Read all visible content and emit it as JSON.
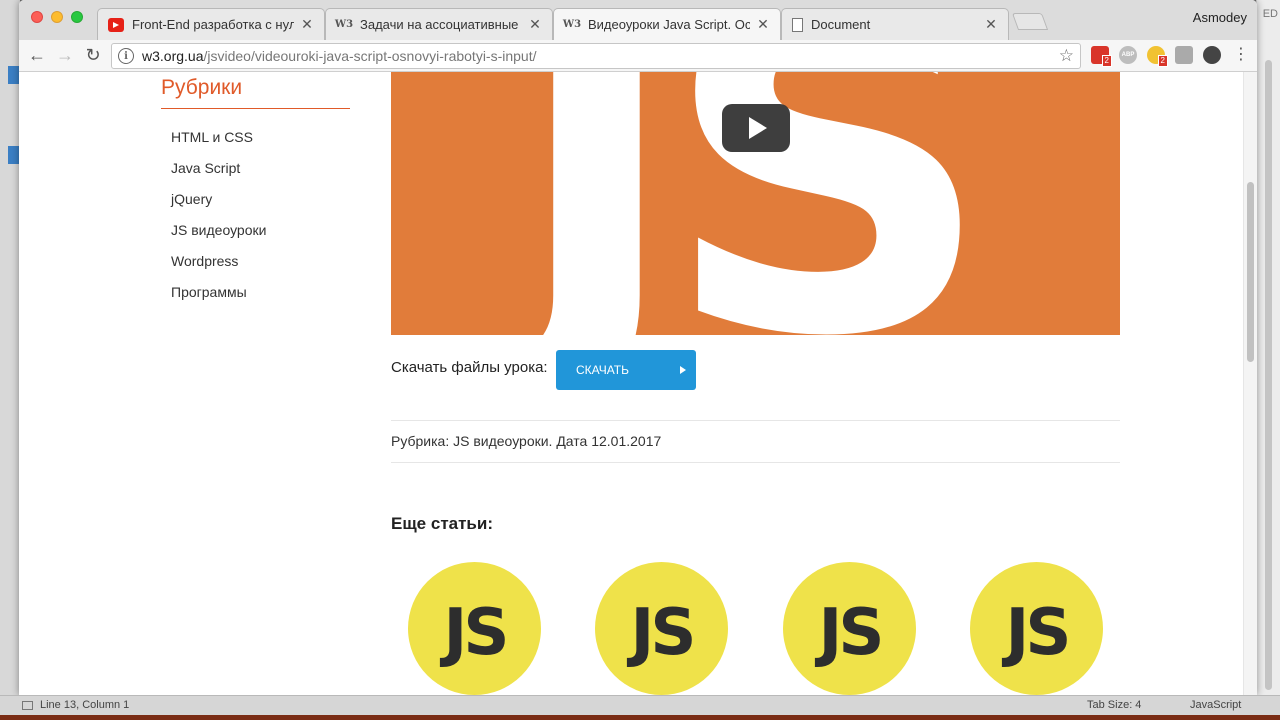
{
  "browser": {
    "profile": "Asmodey",
    "tabs": [
      {
        "title": "Front-End разработка с нуля",
        "favicon": "youtube-icon"
      },
      {
        "title": "Задачи на ассоциативные ма",
        "favicon": "w3-icon"
      },
      {
        "title": "Видеоуроки Java Script. Осно",
        "favicon": "w3-icon",
        "active": true
      },
      {
        "title": "Document",
        "favicon": "document-icon"
      }
    ],
    "url_host": "w3.org.ua",
    "url_path": "/jsvideo/videouroki-java-script-osnovyi-rabotyi-s-input/",
    "extension_badges": [
      "2",
      "2"
    ],
    "abp_label": "ABP"
  },
  "sidebar": {
    "title": "Рубрики",
    "items": [
      {
        "label": "HTML и CSS"
      },
      {
        "label": "Java Script"
      },
      {
        "label": "jQuery"
      },
      {
        "label": "JS видеоуроки"
      },
      {
        "label": "Wordpress"
      },
      {
        "label": "Программы"
      }
    ]
  },
  "video": {
    "poster_text": "JS"
  },
  "download": {
    "label": "Скачать файлы урока:",
    "button": "СКАЧАТЬ"
  },
  "meta": {
    "text": "Рубрика: JS видеоуроки. Дата 12.01.2017"
  },
  "more": {
    "title": "Еще статьи:",
    "thumbs": [
      "JS",
      "JS",
      "JS",
      "JS"
    ]
  },
  "editor": {
    "status_left": "Line 13, Column 1",
    "tab_size": "Tab Size: 4",
    "language": "JavaScript",
    "corner_text": "ED"
  },
  "colors": {
    "accent": "#e05a29",
    "video_bg": "#e17c3a",
    "button": "#2196d9",
    "js_yellow": "#efe24a"
  }
}
